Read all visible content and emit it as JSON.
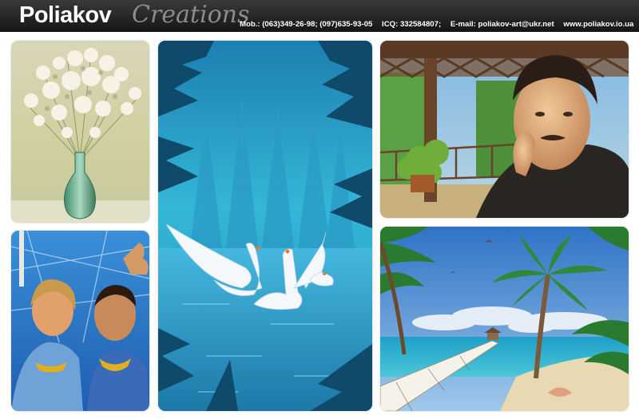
{
  "header": {
    "brand_main": "Poliakov",
    "brand_script": "Creations",
    "mobile": "Mob.: (063)349-26-98; (097)635-93-05",
    "icq": "ICQ: 332584807;",
    "email": "E-mail: poliakov-art@ukr.net",
    "website": "www.poliakov.io.ua"
  },
  "colors": {
    "header_bg": "#1f1f1f",
    "brand_text": "#ffffff",
    "script_text": "#8c8c8c",
    "page_bg": "#ffffff"
  },
  "gallery": [
    {
      "name": "flowers-vase-painting",
      "subject": "white flowers in green glass vase"
    },
    {
      "name": "swans-lake-painting",
      "subject": "swans on a blue forest lake"
    },
    {
      "name": "man-portrait-painting",
      "subject": "portrait of a man in a gazebo"
    },
    {
      "name": "couple-portrait-painting",
      "subject": "couple by a pool"
    },
    {
      "name": "tropical-beach-painting",
      "subject": "palm trees and pier by the sea"
    }
  ]
}
